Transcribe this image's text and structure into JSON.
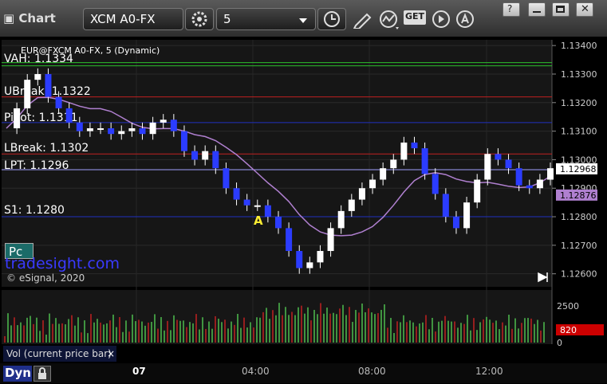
{
  "window": {
    "title": "Chart",
    "symbol": "XCM A0-FX",
    "interval": "5"
  },
  "toolbar": {
    "icons": [
      "settings-gear-icon",
      "clock-icon",
      "pencil-icon",
      "study-icon",
      "get-icon",
      "play-icon",
      "search-icon"
    ],
    "get_label": "GET"
  },
  "window_controls": [
    "restore-icon",
    "minimize-icon",
    "maximize-icon",
    "close-icon"
  ],
  "chart": {
    "header": "EUR@FXCM A0-FX, 5 (Dynamic)",
    "watermark": "tradesight.com",
    "copyright": "© eSignal, 2020",
    "pc_button": "Pc",
    "volume_label": "Vol (current price bar)",
    "bottom_label": "Dyn",
    "close_x": "×"
  },
  "chart_data": {
    "type": "candlestick",
    "title": "",
    "price_axis": {
      "ylim": [
        1.1256,
        1.1342
      ],
      "ticks": [
        1.134,
        1.133,
        1.132,
        1.131,
        1.13,
        1.129,
        1.128,
        1.127,
        1.126
      ]
    },
    "price_axis_tick_labels": [
      "1.13400",
      "1.13300",
      "1.13200",
      "1.13100",
      "1.13000",
      "1.12900",
      "1.12800",
      "1.12700",
      "1.12600"
    ],
    "time_axis": {
      "labels": [
        "07",
        "04:00",
        "08:00",
        "12:00"
      ]
    },
    "levels": [
      {
        "label": "VAH: 1.1334",
        "value": 1.1334,
        "color": "#2bc02b"
      },
      {
        "label": "UBreak: 1.1322",
        "value": 1.1322,
        "color": "#c02020"
      },
      {
        "label": "Pivot: 1.1311",
        "value": 1.1313,
        "color": "#2030c0"
      },
      {
        "label": "LBreak: 1.1302",
        "value": 1.1302,
        "color": "#c02020"
      },
      {
        "label": "LPT: 1.1296",
        "value": 1.12965,
        "color": "#a0a0ff"
      },
      {
        "label": "S1: 1.1280",
        "value": 1.128,
        "color": "#2030c0"
      }
    ],
    "current_price": {
      "label": "1.12968",
      "value": 1.12968
    },
    "moving_average": {
      "label": "1.12876",
      "value": 1.12876,
      "color": "#b080d0"
    },
    "annotation": "A",
    "volume_axis": {
      "ticks": [
        2500,
        0
      ],
      "current": "820"
    },
    "series": [
      {
        "name": "Price",
        "values": [
          1.1311,
          1.1318,
          1.1328,
          1.133,
          1.1322,
          1.1318,
          1.1313,
          1.131,
          1.1311,
          1.1311,
          1.1309,
          1.131,
          1.1311,
          1.1309,
          1.1313,
          1.1314,
          1.131,
          1.1303,
          1.13,
          1.1303,
          1.1297,
          1.129,
          1.1286,
          1.1284,
          1.1284,
          1.128,
          1.1276,
          1.1268,
          1.1262,
          1.1264,
          1.1268,
          1.1276,
          1.1282,
          1.1286,
          1.129,
          1.1293,
          1.1297,
          1.13,
          1.1306,
          1.1304,
          1.1295,
          1.1288,
          1.128,
          1.1276,
          1.1285,
          1.1293,
          1.1302,
          1.13,
          1.1297,
          1.1291,
          1.129,
          1.1293,
          1.1297
        ]
      }
    ]
  }
}
